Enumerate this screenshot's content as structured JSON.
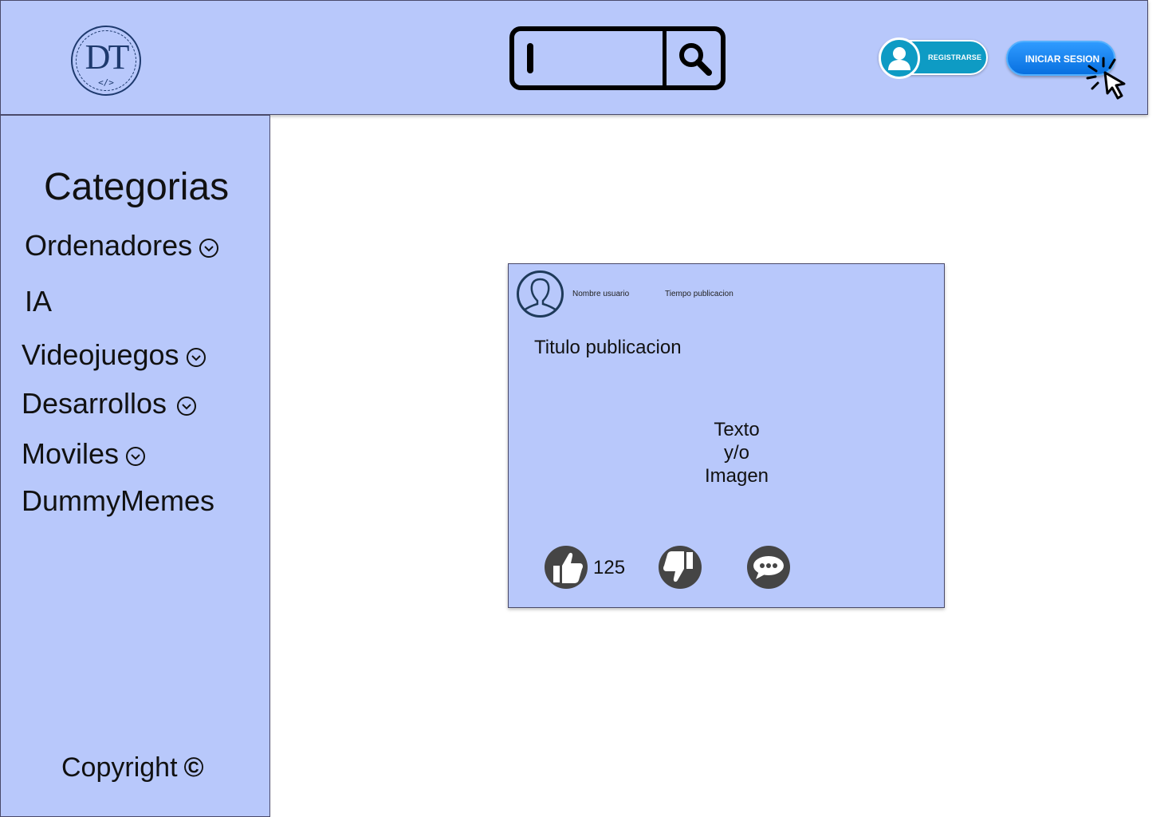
{
  "header": {
    "logo": {
      "letters": "DT",
      "tag": "</>"
    },
    "search": {
      "value": "",
      "placeholder": ""
    },
    "register_label": "REGISTRARSE",
    "login_label": "INICIAR SESION"
  },
  "sidebar": {
    "title": "Categorias",
    "items": [
      {
        "label": "Ordenadores",
        "has_dropdown": true
      },
      {
        "label": "IA",
        "has_dropdown": false
      },
      {
        "label": "Videojuegos",
        "has_dropdown": true
      },
      {
        "label": "Desarrollos",
        "has_dropdown": true
      },
      {
        "label": "Moviles",
        "has_dropdown": true
      },
      {
        "label": "DummyMemes",
        "has_dropdown": false
      }
    ],
    "copyright": "Copyright",
    "copyright_symbol": "©"
  },
  "post": {
    "user_name": "Nombre usuario",
    "time": "Tiempo publicacion",
    "title": "Titulo publicacion",
    "body_lines": [
      "Texto",
      "y/o",
      "Imagen"
    ],
    "like_count": "125"
  },
  "icons": {
    "logo": "dt-logo-icon",
    "search": "magnifier-icon",
    "register": "user-icon",
    "pointer": "click-cursor-icon",
    "dropdown": "chevron-down-circle-icon",
    "avatar": "user-outline-icon",
    "like": "thumbs-up-icon",
    "dislike": "thumbs-down-icon",
    "comment": "speech-bubble-icon"
  },
  "colors": {
    "panel": "#b8c8fb",
    "register_button": "#0e9bc4",
    "login_button": "#0870e0",
    "logo": "#1e3a6e",
    "reaction_icon": "#454545"
  }
}
